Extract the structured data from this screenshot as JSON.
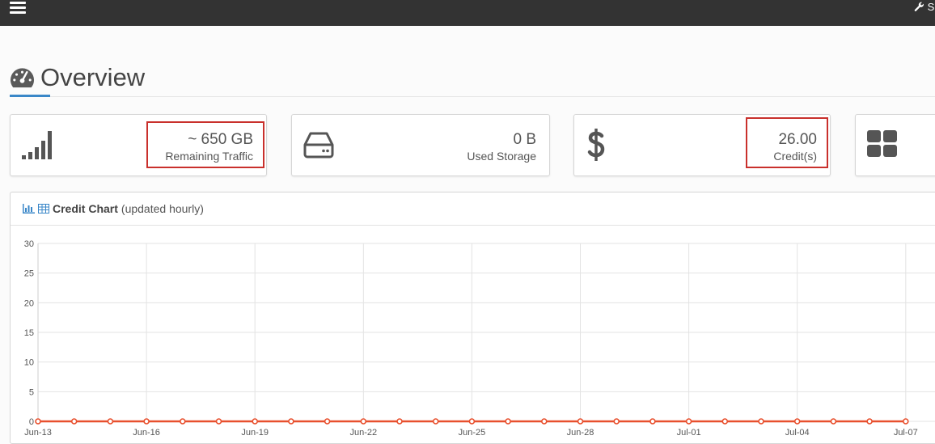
{
  "header": {
    "settings_label": "S"
  },
  "page": {
    "title": "Overview"
  },
  "cards": {
    "traffic": {
      "value": "~ 650 GB",
      "label": "Remaining Traffic",
      "icon": "signal-bars-icon"
    },
    "storage": {
      "value": "0 B",
      "label": "Used Storage",
      "icon": "hard-drive-icon"
    },
    "credits": {
      "value": "26.00",
      "label": "Credit(s)",
      "icon": "dollar-icon"
    },
    "fourth": {
      "icon": "grid-icon"
    }
  },
  "panel": {
    "title": "Credit Chart",
    "subtitle": "(updated hourly)"
  },
  "colors": {
    "topbar": "#333333",
    "accent": "#3a87c8",
    "highlight": "#c9302c",
    "series": "#e8502e"
  },
  "chart_data": {
    "type": "line",
    "title": "Credit Chart",
    "xlabel": "",
    "ylabel": "",
    "ylim": [
      0,
      30
    ],
    "yticks": [
      "0",
      "5",
      "10",
      "15",
      "20",
      "25",
      "30"
    ],
    "xtick_labels": [
      "Jun-13",
      "Jun-16",
      "Jun-19",
      "Jun-22",
      "Jun-25",
      "Jun-28",
      "Jul-01",
      "Jul-04",
      "Jul-07"
    ],
    "x": [
      "Jun-13",
      "Jun-14",
      "Jun-15",
      "Jun-16",
      "Jun-17",
      "Jun-18",
      "Jun-19",
      "Jun-20",
      "Jun-21",
      "Jun-22",
      "Jun-23",
      "Jun-24",
      "Jun-25",
      "Jun-26",
      "Jun-27",
      "Jun-28",
      "Jun-29",
      "Jun-30",
      "Jul-01",
      "Jul-02",
      "Jul-03",
      "Jul-04",
      "Jul-05",
      "Jul-06",
      "Jul-07"
    ],
    "series": [
      {
        "values": [
          0,
          0,
          0,
          0,
          0,
          0,
          0,
          0,
          0,
          0,
          0,
          0,
          0,
          0,
          0,
          0,
          0,
          0,
          0,
          0,
          0,
          0,
          0,
          0,
          0
        ]
      }
    ],
    "grid": true
  }
}
